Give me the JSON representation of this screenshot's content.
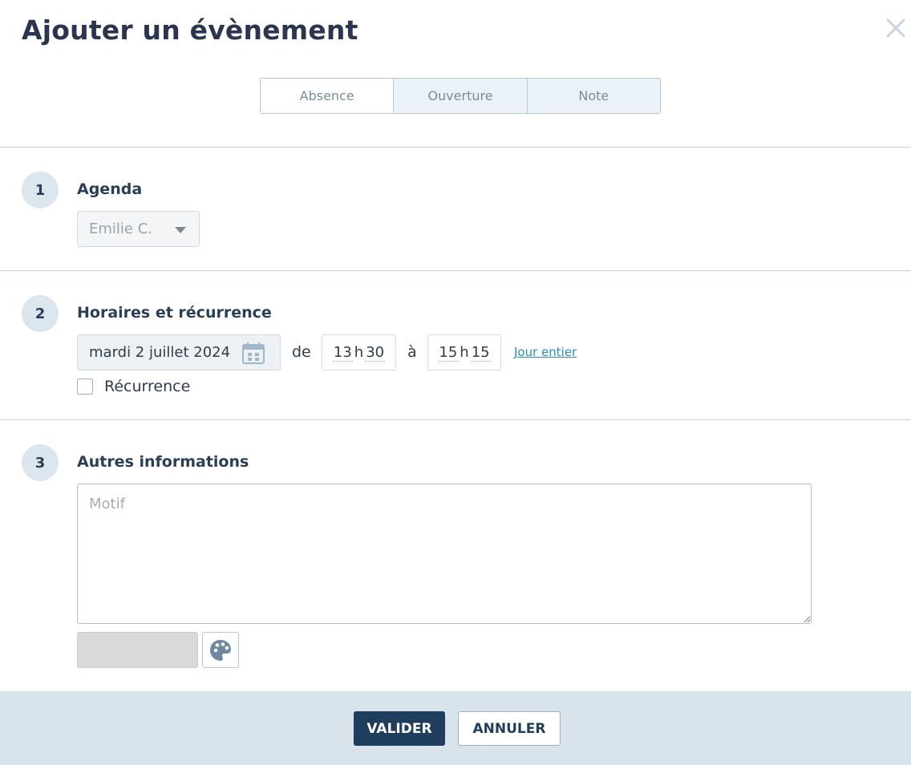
{
  "dialog": {
    "title": "Ajouter un évènement",
    "close_icon": "close-icon"
  },
  "tabs": [
    {
      "label": "Absence",
      "selected": false
    },
    {
      "label": "Ouverture",
      "selected": false
    },
    {
      "label": "Note",
      "selected": false
    }
  ],
  "sections": {
    "agenda": {
      "number": "1",
      "title": "Agenda",
      "selected_value": "Emilie C."
    },
    "schedule": {
      "number": "2",
      "title": "Horaires et récurrence",
      "date": "mardi 2 juillet 2024",
      "from_label": "de",
      "start_hour": "13",
      "start_minute": "30",
      "to_label": "à",
      "end_hour": "15",
      "end_minute": "15",
      "hour_separator": "h",
      "all_day_link": "Jour entier",
      "recurrence_label": "Récurrence",
      "recurrence_checked": false
    },
    "other": {
      "number": "3",
      "title": "Autres informations",
      "motif_placeholder": "Motif",
      "motif_value": "",
      "color_value": "#d9d9d9"
    }
  },
  "footer": {
    "validate_label": "VALIDER",
    "cancel_label": "ANNULER"
  },
  "colors": {
    "primary": "#1f3d5d",
    "link": "#2d8fb5",
    "footer_bg": "#d8e3eb",
    "step_badge_bg": "#dce6ee"
  }
}
